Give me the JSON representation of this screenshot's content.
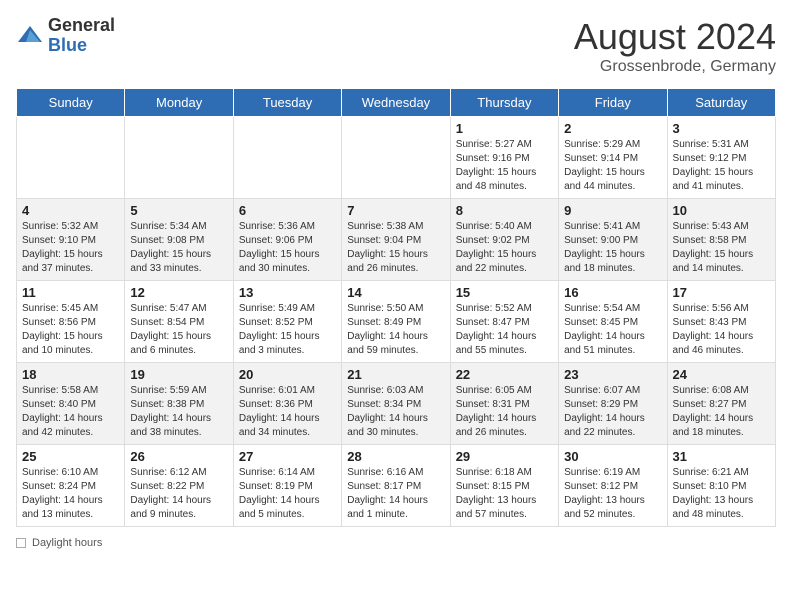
{
  "header": {
    "logo_general": "General",
    "logo_blue": "Blue",
    "month_year": "August 2024",
    "location": "Grossenbrode, Germany"
  },
  "days_of_week": [
    "Sunday",
    "Monday",
    "Tuesday",
    "Wednesday",
    "Thursday",
    "Friday",
    "Saturday"
  ],
  "weeks": [
    [
      {
        "day": "",
        "info": ""
      },
      {
        "day": "",
        "info": ""
      },
      {
        "day": "",
        "info": ""
      },
      {
        "day": "",
        "info": ""
      },
      {
        "day": "1",
        "info": "Sunrise: 5:27 AM\nSunset: 9:16 PM\nDaylight: 15 hours\nand 48 minutes."
      },
      {
        "day": "2",
        "info": "Sunrise: 5:29 AM\nSunset: 9:14 PM\nDaylight: 15 hours\nand 44 minutes."
      },
      {
        "day": "3",
        "info": "Sunrise: 5:31 AM\nSunset: 9:12 PM\nDaylight: 15 hours\nand 41 minutes."
      }
    ],
    [
      {
        "day": "4",
        "info": "Sunrise: 5:32 AM\nSunset: 9:10 PM\nDaylight: 15 hours\nand 37 minutes."
      },
      {
        "day": "5",
        "info": "Sunrise: 5:34 AM\nSunset: 9:08 PM\nDaylight: 15 hours\nand 33 minutes."
      },
      {
        "day": "6",
        "info": "Sunrise: 5:36 AM\nSunset: 9:06 PM\nDaylight: 15 hours\nand 30 minutes."
      },
      {
        "day": "7",
        "info": "Sunrise: 5:38 AM\nSunset: 9:04 PM\nDaylight: 15 hours\nand 26 minutes."
      },
      {
        "day": "8",
        "info": "Sunrise: 5:40 AM\nSunset: 9:02 PM\nDaylight: 15 hours\nand 22 minutes."
      },
      {
        "day": "9",
        "info": "Sunrise: 5:41 AM\nSunset: 9:00 PM\nDaylight: 15 hours\nand 18 minutes."
      },
      {
        "day": "10",
        "info": "Sunrise: 5:43 AM\nSunset: 8:58 PM\nDaylight: 15 hours\nand 14 minutes."
      }
    ],
    [
      {
        "day": "11",
        "info": "Sunrise: 5:45 AM\nSunset: 8:56 PM\nDaylight: 15 hours\nand 10 minutes."
      },
      {
        "day": "12",
        "info": "Sunrise: 5:47 AM\nSunset: 8:54 PM\nDaylight: 15 hours\nand 6 minutes."
      },
      {
        "day": "13",
        "info": "Sunrise: 5:49 AM\nSunset: 8:52 PM\nDaylight: 15 hours\nand 3 minutes."
      },
      {
        "day": "14",
        "info": "Sunrise: 5:50 AM\nSunset: 8:49 PM\nDaylight: 14 hours\nand 59 minutes."
      },
      {
        "day": "15",
        "info": "Sunrise: 5:52 AM\nSunset: 8:47 PM\nDaylight: 14 hours\nand 55 minutes."
      },
      {
        "day": "16",
        "info": "Sunrise: 5:54 AM\nSunset: 8:45 PM\nDaylight: 14 hours\nand 51 minutes."
      },
      {
        "day": "17",
        "info": "Sunrise: 5:56 AM\nSunset: 8:43 PM\nDaylight: 14 hours\nand 46 minutes."
      }
    ],
    [
      {
        "day": "18",
        "info": "Sunrise: 5:58 AM\nSunset: 8:40 PM\nDaylight: 14 hours\nand 42 minutes."
      },
      {
        "day": "19",
        "info": "Sunrise: 5:59 AM\nSunset: 8:38 PM\nDaylight: 14 hours\nand 38 minutes."
      },
      {
        "day": "20",
        "info": "Sunrise: 6:01 AM\nSunset: 8:36 PM\nDaylight: 14 hours\nand 34 minutes."
      },
      {
        "day": "21",
        "info": "Sunrise: 6:03 AM\nSunset: 8:34 PM\nDaylight: 14 hours\nand 30 minutes."
      },
      {
        "day": "22",
        "info": "Sunrise: 6:05 AM\nSunset: 8:31 PM\nDaylight: 14 hours\nand 26 minutes."
      },
      {
        "day": "23",
        "info": "Sunrise: 6:07 AM\nSunset: 8:29 PM\nDaylight: 14 hours\nand 22 minutes."
      },
      {
        "day": "24",
        "info": "Sunrise: 6:08 AM\nSunset: 8:27 PM\nDaylight: 14 hours\nand 18 minutes."
      }
    ],
    [
      {
        "day": "25",
        "info": "Sunrise: 6:10 AM\nSunset: 8:24 PM\nDaylight: 14 hours\nand 13 minutes."
      },
      {
        "day": "26",
        "info": "Sunrise: 6:12 AM\nSunset: 8:22 PM\nDaylight: 14 hours\nand 9 minutes."
      },
      {
        "day": "27",
        "info": "Sunrise: 6:14 AM\nSunset: 8:19 PM\nDaylight: 14 hours\nand 5 minutes."
      },
      {
        "day": "28",
        "info": "Sunrise: 6:16 AM\nSunset: 8:17 PM\nDaylight: 14 hours\nand 1 minute."
      },
      {
        "day": "29",
        "info": "Sunrise: 6:18 AM\nSunset: 8:15 PM\nDaylight: 13 hours\nand 57 minutes."
      },
      {
        "day": "30",
        "info": "Sunrise: 6:19 AM\nSunset: 8:12 PM\nDaylight: 13 hours\nand 52 minutes."
      },
      {
        "day": "31",
        "info": "Sunrise: 6:21 AM\nSunset: 8:10 PM\nDaylight: 13 hours\nand 48 minutes."
      }
    ]
  ],
  "footer": {
    "daylight_label": "Daylight hours"
  }
}
